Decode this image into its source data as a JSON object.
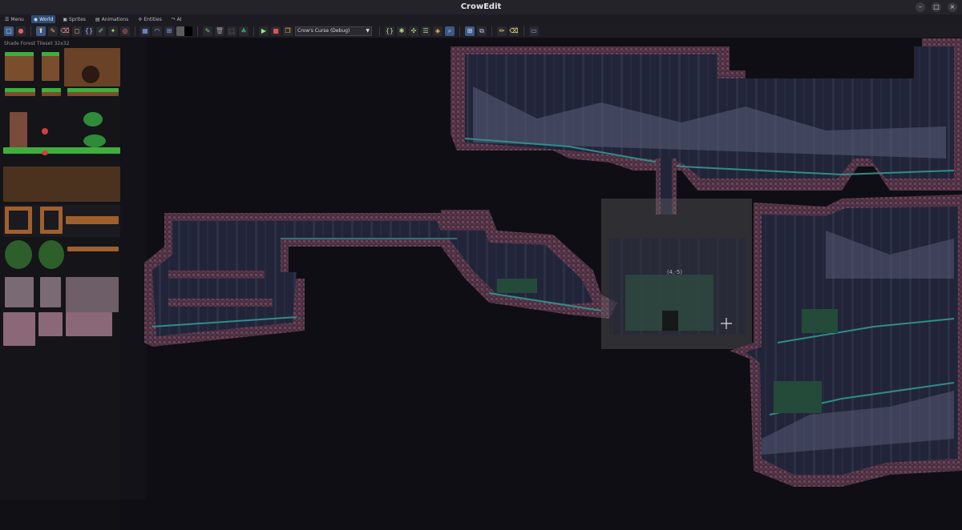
{
  "window": {
    "title": "CrowEdit"
  },
  "menubar": {
    "items": [
      {
        "label": "Menu",
        "icon": "hamburger-icon"
      },
      {
        "label": "World",
        "icon": "globe-icon"
      },
      {
        "label": "Sprites",
        "icon": "image-icon"
      },
      {
        "label": "Animations",
        "icon": "film-icon"
      },
      {
        "label": "Entities",
        "icon": "entity-icon"
      },
      {
        "label": "AI",
        "icon": "ai-icon"
      }
    ],
    "active": "World"
  },
  "toolbar": {
    "scene_select": "Crow's Curse (Debug)"
  },
  "tileset_panel": {
    "title": "Shade Forest Tileset 32x32"
  },
  "canvas": {
    "room_coordinate": "(4,-5)"
  },
  "colors": {
    "accent": "#3d5a86",
    "cave_rock": "#5d3a4f",
    "cave_fill": "#2a2d3e",
    "water": "#2f8e8a",
    "selection_overlay": "#6a6a6e"
  }
}
